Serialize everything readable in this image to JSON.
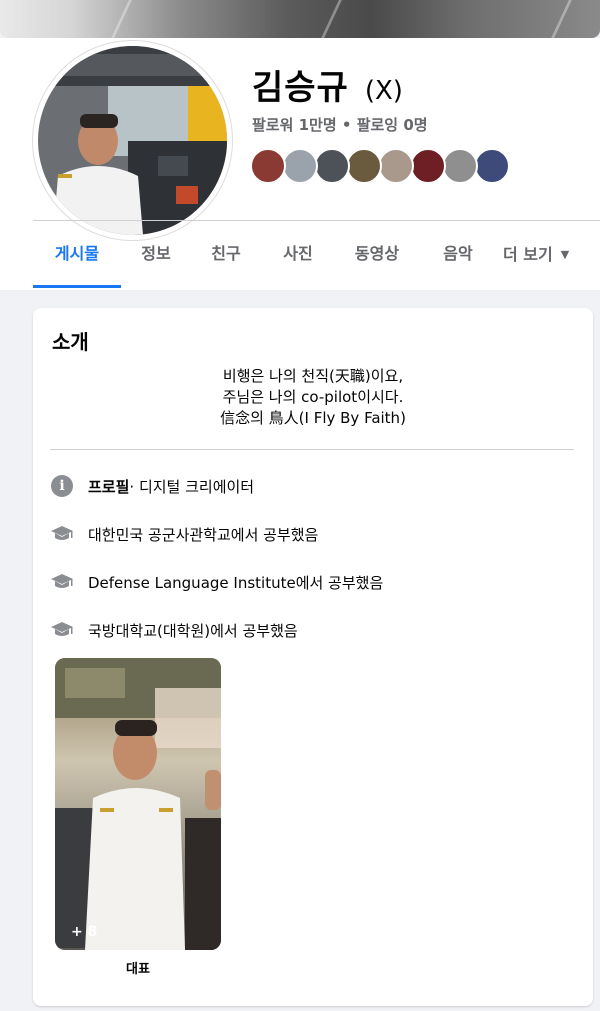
{
  "profile": {
    "name": "김승규",
    "alternate_name": "(X)",
    "follow_stats": "팔로워 1만명 • 팔로잉 0명"
  },
  "tabs": [
    {
      "label": "게시물",
      "active": true
    },
    {
      "label": "정보"
    },
    {
      "label": "친구"
    },
    {
      "label": "사진"
    },
    {
      "label": "동영상"
    },
    {
      "label": "음악"
    },
    {
      "label": "더 보기"
    }
  ],
  "intro": {
    "title": "소개",
    "bio": [
      "비행은 나의 천직(天職)이요,",
      "주님은 나의 co-pilot이시다.",
      "信念의 鳥人(I Fly By Faith)"
    ],
    "profile_label": "프로필",
    "profile_category": " · 디지털 크리에이터",
    "education": [
      "대한민국 공군사관학교에서 공부했음",
      "Defense Language Institute에서 공부했음",
      "국방대학교(대학원)에서 공부했음"
    ],
    "featured_more": "+ 8",
    "featured_label": "대표"
  },
  "icons": {
    "info": "info-icon",
    "education": "graduation-cap-icon",
    "more": "caret-down-icon"
  },
  "colors": {
    "accent": "#1877f2",
    "secondary_text": "#65676b",
    "page_background": "#f0f2f5"
  }
}
